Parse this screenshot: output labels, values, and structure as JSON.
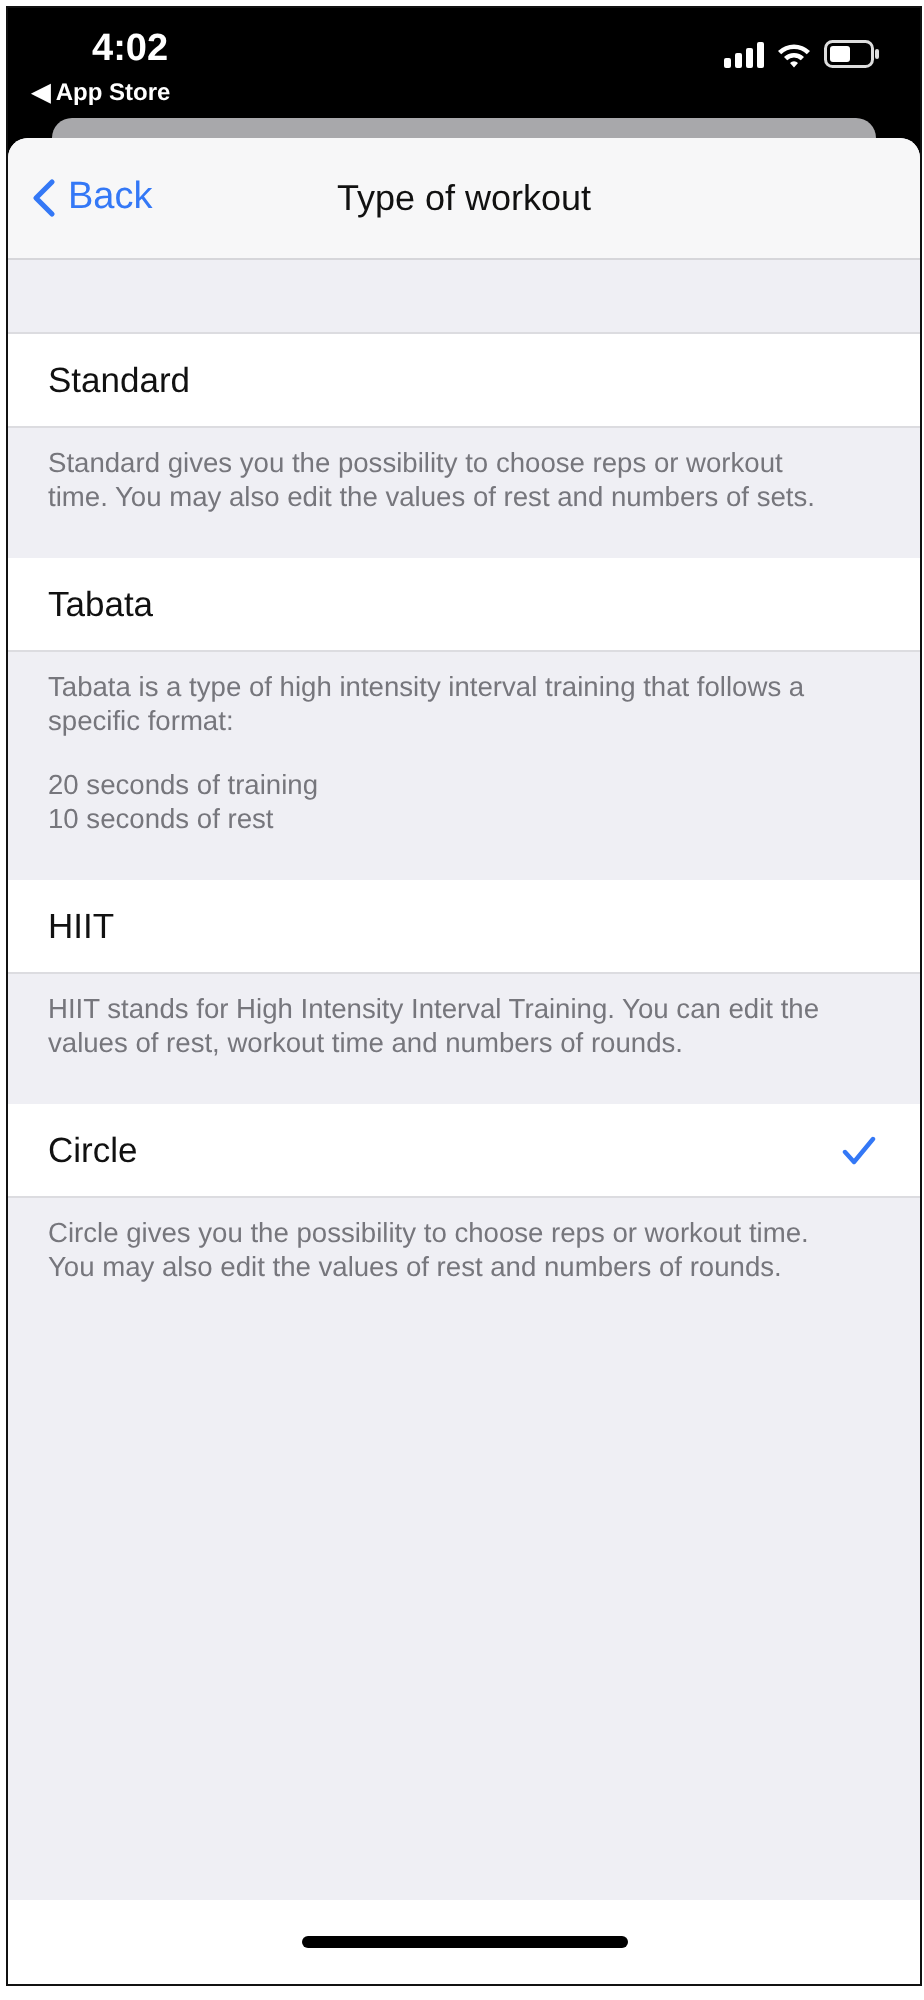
{
  "status_bar": {
    "time": "4:02",
    "back_label": "◀ App Store"
  },
  "nav": {
    "back": "Back",
    "title": "Type of workout"
  },
  "options": [
    {
      "title": "Standard",
      "selected": false,
      "description": [
        "Standard gives you the possibility to choose reps or workout time. You may also edit the values of rest and numbers of sets."
      ]
    },
    {
      "title": "Tabata",
      "selected": false,
      "description": [
        "Tabata is a type of high intensity interval training that follows a specific format:",
        "20 seconds of training\n10 seconds of rest"
      ]
    },
    {
      "title": "HIIT",
      "selected": false,
      "description": [
        "HIIT stands for High Intensity Interval Training. You can edit the values of rest, workout time and numbers of rounds."
      ]
    },
    {
      "title": "Circle",
      "selected": true,
      "description": [
        "Circle gives you the possibility to choose reps or workout  time. You may also edit the values of rest and numbers of rounds."
      ]
    }
  ]
}
